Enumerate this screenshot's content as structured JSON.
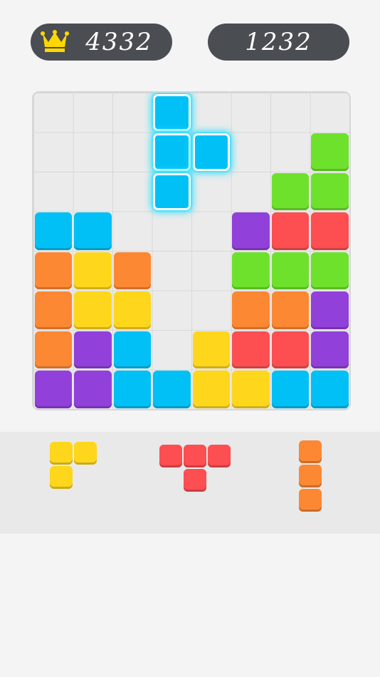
{
  "scores": {
    "best": "4332",
    "current": "1232"
  },
  "icons": {
    "crown": "crown-icon"
  },
  "colors": {
    "blue": "#00c0f5",
    "green": "#6ee12c",
    "red": "#fd4e52",
    "purple": "#9140d9",
    "orange": "#fc8833",
    "yellow": "#fed61c",
    "glow": "#36e0ff",
    "crown": "#ffd800"
  },
  "board": {
    "rows": 8,
    "cols": 8,
    "cells": [
      [
        null,
        null,
        null,
        null,
        null,
        null,
        null,
        null
      ],
      [
        null,
        null,
        null,
        null,
        null,
        null,
        null,
        "green"
      ],
      [
        null,
        null,
        null,
        null,
        null,
        null,
        "green",
        "green"
      ],
      [
        "blue",
        "blue",
        null,
        null,
        null,
        "purple",
        "red",
        "red"
      ],
      [
        "orange",
        "yellow",
        "orange",
        null,
        null,
        "green",
        "green",
        "green"
      ],
      [
        "orange",
        "yellow",
        "yellow",
        null,
        null,
        "orange",
        "orange",
        "purple"
      ],
      [
        "orange",
        "purple",
        "blue",
        null,
        "yellow",
        "red",
        "red",
        "purple"
      ],
      [
        "purple",
        "purple",
        "blue",
        "blue",
        "yellow",
        "yellow",
        "blue",
        "blue"
      ]
    ],
    "dragging_piece": {
      "color": "blue",
      "cells": [
        [
          0,
          3
        ],
        [
          1,
          3
        ],
        [
          1,
          4
        ],
        [
          2,
          3
        ]
      ]
    }
  },
  "tray": {
    "pieces": [
      {
        "name": "yellow-corner-piece",
        "color": "yellow",
        "cells": [
          [
            0,
            0
          ],
          [
            0,
            1
          ],
          [
            1,
            0
          ]
        ]
      },
      {
        "name": "red-t-piece",
        "color": "red",
        "cells": [
          [
            0,
            0
          ],
          [
            0,
            1
          ],
          [
            0,
            2
          ],
          [
            1,
            1
          ]
        ]
      },
      {
        "name": "orange-i-piece",
        "color": "orange",
        "cells": [
          [
            0,
            0
          ],
          [
            1,
            0
          ],
          [
            2,
            0
          ]
        ]
      }
    ]
  }
}
